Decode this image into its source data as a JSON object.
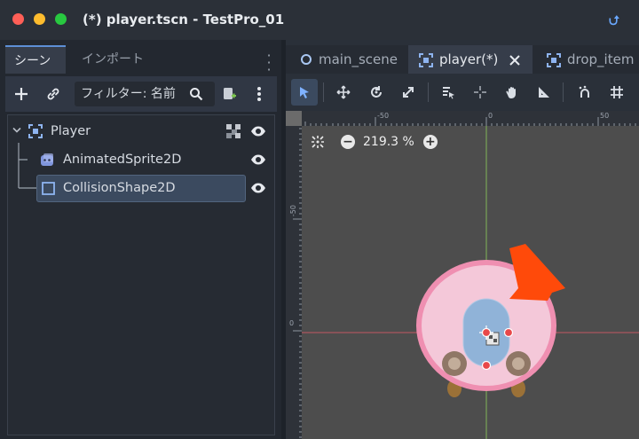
{
  "window": {
    "title": "(*) player.tscn - TestPro_01",
    "title_icon": "git-branch-icon"
  },
  "left_dock": {
    "tabs": [
      {
        "label": "シーン",
        "active": true
      },
      {
        "label": "インポート",
        "active": false
      }
    ],
    "filter_placeholder": "フィルター: 名前",
    "tree": [
      {
        "label": "Player",
        "type": "Node2D",
        "depth": 0
      },
      {
        "label": "AnimatedSprite2D",
        "type": "AnimatedSprite2D",
        "depth": 1
      },
      {
        "label": "CollisionShape2D",
        "type": "CollisionShape2D",
        "depth": 1,
        "selected": true
      }
    ]
  },
  "editor": {
    "scene_tabs": [
      {
        "label": "main_scene",
        "icon": "circle-icon",
        "active": false
      },
      {
        "label": "player(*)",
        "icon": "node2d-icon",
        "active": true
      },
      {
        "label": "drop_item",
        "icon": "node2d-icon",
        "active": false
      }
    ],
    "viewport": {
      "zoom_label": "219.3 %",
      "ruler_top": [
        "-50",
        "0",
        "50"
      ],
      "ruler_left": [
        "-50",
        "0"
      ]
    }
  },
  "colors": {
    "accent": "#5d8fd6",
    "selection_bg": "#3b4a5f",
    "viewport_bg": "#4d4d4d",
    "sprite_body": "#f4c8d9",
    "sprite_outline": "#ef8fb1",
    "collision_fill": "#7fb0d8",
    "arrow": "#ff4a0a"
  }
}
